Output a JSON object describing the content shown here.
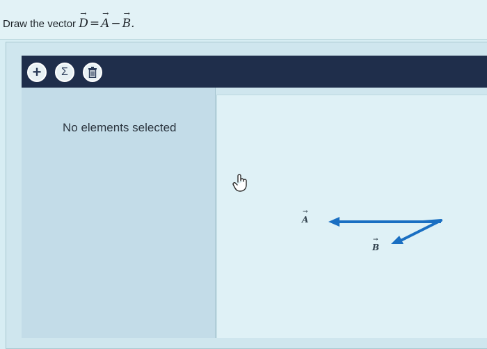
{
  "question": {
    "prefix": "Draw the vector",
    "vector_d": "D",
    "equals": "=",
    "vector_a": "A",
    "minus": "−",
    "vector_b": "B",
    "suffix": "."
  },
  "toolbar": {
    "add_symbol": "+",
    "sum_symbol": "Σ"
  },
  "panel": {
    "status_text": "No elements selected"
  },
  "canvas": {
    "label_a": "A",
    "label_b": "B",
    "vector_color": "#1a6fc2"
  },
  "colors": {
    "toolbar_bg": "#1f2e4b",
    "panel_bg": "#c3dce8",
    "canvas_bg": "#dff1f6"
  }
}
